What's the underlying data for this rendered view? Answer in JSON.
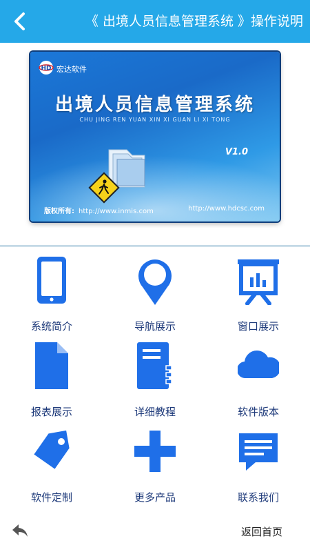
{
  "header": {
    "title": "《 出境人员信息管理系统 》操作说明",
    "background": "#25a8e8"
  },
  "banner": {
    "brand": "宏达软件",
    "brand_logo_text": "HD",
    "app_title": "出境人员信息管理系统",
    "app_pinyin": "CHU JING REN YUAN XIN XI GUAN LI XI TONG",
    "version": "V1.0",
    "copyright_label": "版权所有:",
    "url1": "http://www.inmis.com",
    "url2": "http://www.hdcsc.com"
  },
  "grid": {
    "icon_color": "#1f6fe8",
    "items": [
      {
        "label": "系统简介",
        "icon": "phone-icon"
      },
      {
        "label": "导航展示",
        "icon": "location-pin-icon"
      },
      {
        "label": "窗口展示",
        "icon": "presentation-icon"
      },
      {
        "label": "报表展示",
        "icon": "document-icon"
      },
      {
        "label": "详细教程",
        "icon": "notebook-icon"
      },
      {
        "label": "软件版本",
        "icon": "cloud-icon"
      },
      {
        "label": "软件定制",
        "icon": "tag-icon"
      },
      {
        "label": "更多产品",
        "icon": "plus-icon"
      },
      {
        "label": "联系我们",
        "icon": "message-icon"
      }
    ]
  },
  "footer": {
    "home_label": "返回首页"
  }
}
